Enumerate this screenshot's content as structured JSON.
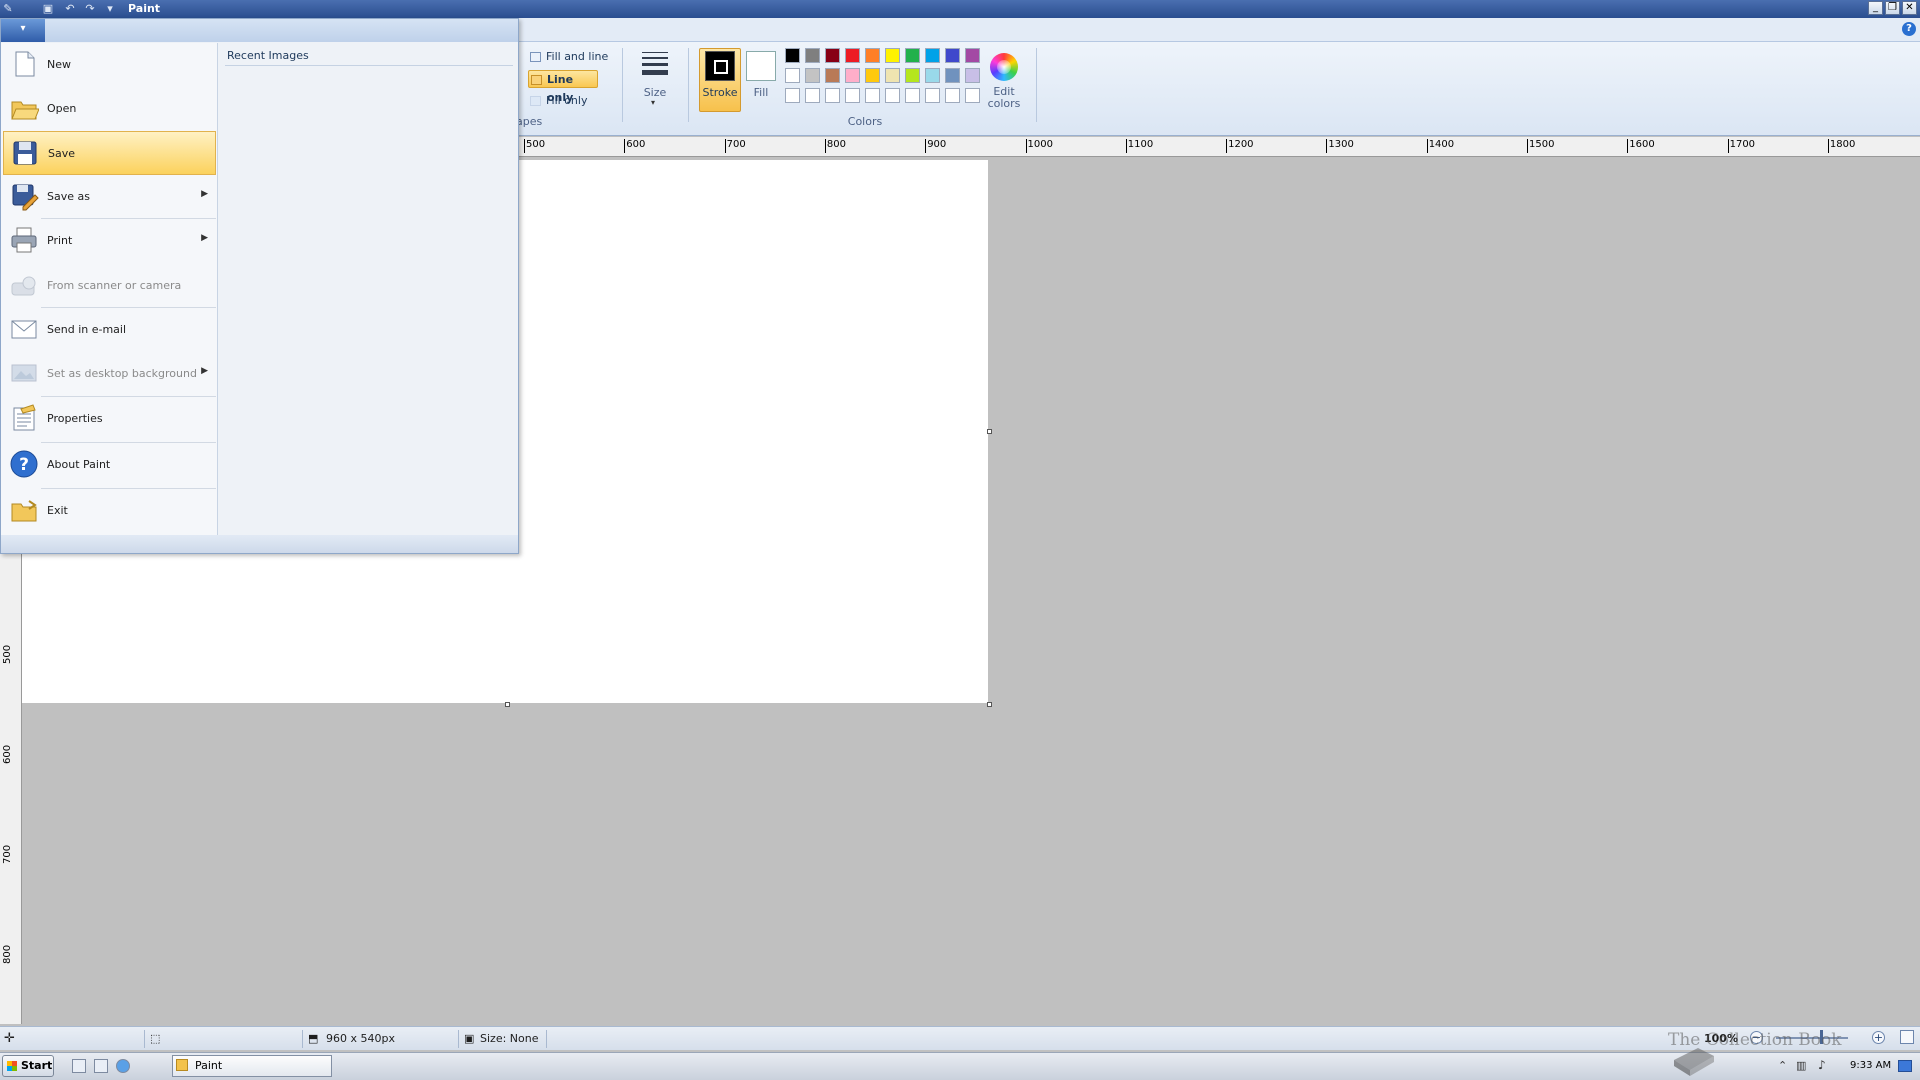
{
  "window": {
    "title": "Paint"
  },
  "ribbon": {
    "shape_options": [
      "Fill and line",
      "Line only",
      "Fill only"
    ],
    "shapes_group_label": "apes",
    "size_label": "Size",
    "stroke_label": "Stroke",
    "fill_label": "Fill",
    "edit_colors_label": "Edit colors",
    "colors_group_label": "Colors",
    "palette": [
      [
        "#000000",
        "#7f7f7f",
        "#880015",
        "#ed1c24",
        "#ff7f27",
        "#fff200",
        "#22b14c",
        "#00a2e8",
        "#3f48cc",
        "#a349a4"
      ],
      [
        "#ffffff",
        "#c3c3c3",
        "#b97a57",
        "#ffaec9",
        "#ffc90e",
        "#efe4b0",
        "#b5e61d",
        "#99d9ea",
        "#7092be",
        "#c8bfe7"
      ],
      [
        "#ffffff",
        "#ffffff",
        "#ffffff",
        "#ffffff",
        "#ffffff",
        "#ffffff",
        "#ffffff",
        "#ffffff",
        "#ffffff",
        "#ffffff"
      ]
    ]
  },
  "ruler": {
    "top_ticks": [
      "500",
      "600",
      "700",
      "800",
      "900",
      "1000",
      "1100",
      "1200",
      "1300",
      "1400",
      "1500",
      "1600",
      "1700",
      "1800"
    ],
    "left_ticks": [
      "500",
      "600",
      "700",
      "800"
    ]
  },
  "file_menu": {
    "items": [
      {
        "label": "New",
        "icon": "new-file-icon",
        "disabled": false,
        "submenu": false
      },
      {
        "label": "Open",
        "icon": "open-folder-icon",
        "disabled": false,
        "submenu": false
      },
      {
        "label": "Save",
        "icon": "save-disk-icon",
        "disabled": false,
        "submenu": false,
        "highlighted": true
      },
      {
        "label": "Save as",
        "icon": "save-as-icon",
        "disabled": false,
        "submenu": true
      },
      {
        "label": "Print",
        "icon": "printer-icon",
        "disabled": false,
        "submenu": true
      },
      {
        "label": "From scanner or camera",
        "icon": "scanner-icon",
        "disabled": true,
        "submenu": false
      },
      {
        "label": "Send in e-mail",
        "icon": "email-icon",
        "disabled": false,
        "submenu": false
      },
      {
        "label": "Set as desktop background",
        "icon": "desktop-background-icon",
        "disabled": true,
        "submenu": true
      },
      {
        "label": "Properties",
        "icon": "properties-icon",
        "disabled": false,
        "submenu": false
      },
      {
        "label": "About Paint",
        "icon": "help-icon",
        "disabled": false,
        "submenu": false
      },
      {
        "label": "Exit",
        "icon": "exit-icon",
        "disabled": false,
        "submenu": false
      }
    ],
    "recent_title": "Recent Images"
  },
  "statusbar": {
    "dimensions": "960 x 540px",
    "size": "Size: None",
    "zoom": "100%"
  },
  "taskbar": {
    "start_label": "Start",
    "task_label": "Paint",
    "clock": "9:33 AM"
  },
  "watermark": "The Collection Book"
}
